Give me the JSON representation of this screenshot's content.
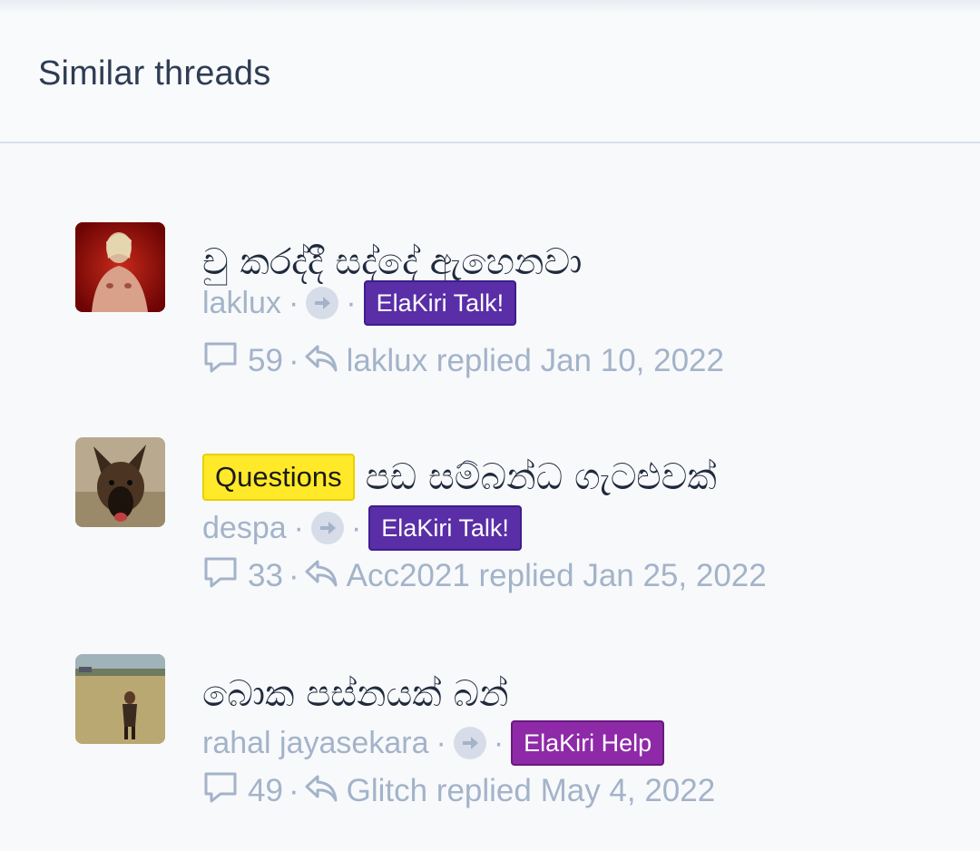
{
  "block": {
    "title": "Similar threads"
  },
  "icons": {
    "forward": "arrow-right-icon",
    "comments": "comment-bubble-icon",
    "reply": "reply-arrow-icon"
  },
  "colors": {
    "title": "#1f2a3d",
    "meta": "#a3b3c9",
    "badge_talk": "#5a2ea6",
    "badge_help": "#8e2aa8",
    "prefix_questions": "#ffe928"
  },
  "threads": [
    {
      "prefix": "",
      "title": "චු කරද්දී සද්දේ ඇහෙනවා",
      "author": "laklux",
      "forum": "ElaKiri Talk!",
      "replies": "59",
      "last_reply": "laklux replied Jan 10, 2022"
    },
    {
      "prefix": "Questions",
      "title": "පඩ සම්බන්ධ ගැටළුවක්",
      "author": "despa",
      "forum": "ElaKiri Talk!",
      "replies": "33",
      "last_reply": "Acc2021 replied Jan 25, 2022"
    },
    {
      "prefix": "",
      "title": "බොක පස්නයක් බන්",
      "author": "rahal jayasekara",
      "forum": "ElaKiri Help",
      "replies": "49",
      "last_reply": "Glitch replied May 4, 2022"
    }
  ]
}
